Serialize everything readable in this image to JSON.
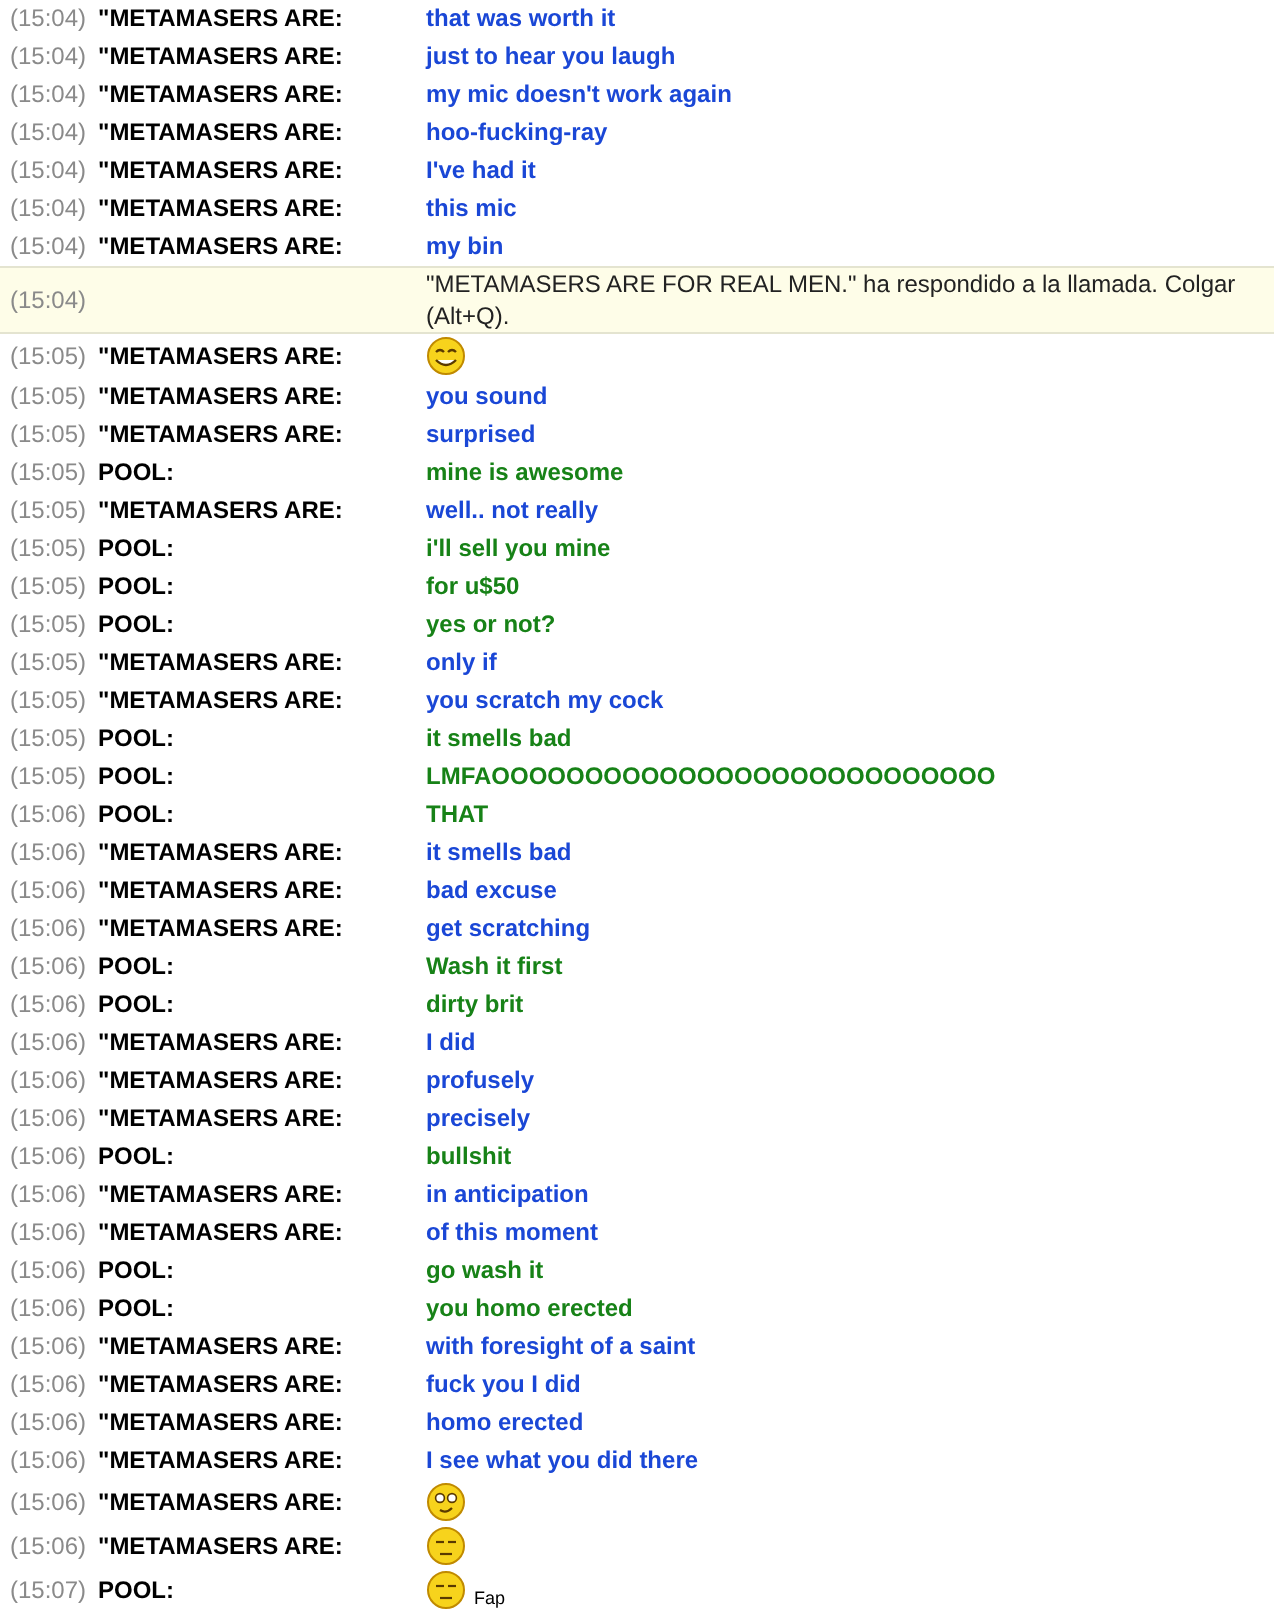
{
  "messages": [
    {
      "kind": "text",
      "time": "(15:04)",
      "sender": "\"METAMASERS ARE:",
      "text": "that was worth it",
      "color": "#1a47d6"
    },
    {
      "kind": "text",
      "time": "(15:04)",
      "sender": "\"METAMASERS ARE:",
      "text": "just to hear you laugh",
      "color": "#1a47d6"
    },
    {
      "kind": "text",
      "time": "(15:04)",
      "sender": "\"METAMASERS ARE:",
      "text": "my mic doesn't work again",
      "color": "#1a47d6"
    },
    {
      "kind": "text",
      "time": "(15:04)",
      "sender": "\"METAMASERS ARE:",
      "text": "hoo-fucking-ray",
      "color": "#1a47d6"
    },
    {
      "kind": "text",
      "time": "(15:04)",
      "sender": "\"METAMASERS ARE:",
      "text": "I've had it",
      "color": "#1a47d6"
    },
    {
      "kind": "text",
      "time": "(15:04)",
      "sender": "\"METAMASERS ARE:",
      "text": "this mic",
      "color": "#1a47d6"
    },
    {
      "kind": "text",
      "time": "(15:04)",
      "sender": "\"METAMASERS ARE:",
      "text": "my bin",
      "color": "#1a47d6"
    },
    {
      "kind": "notice",
      "time": "(15:04)",
      "text": "\"METAMASERS ARE FOR REAL MEN.\" ha respondido a la llamada. Colgar (Alt+Q)."
    },
    {
      "kind": "grin",
      "time": "(15:05)",
      "sender": "\"METAMASERS ARE:"
    },
    {
      "kind": "text",
      "time": "(15:05)",
      "sender": "\"METAMASERS ARE:",
      "text": "you sound",
      "color": "#1a47d6"
    },
    {
      "kind": "text",
      "time": "(15:05)",
      "sender": "\"METAMASERS ARE:",
      "text": "surprised",
      "color": "#1a47d6"
    },
    {
      "kind": "text",
      "time": "(15:05)",
      "sender": "POOL:",
      "text": "mine is awesome",
      "color": "#178217"
    },
    {
      "kind": "text",
      "time": "(15:05)",
      "sender": "\"METAMASERS ARE:",
      "text": "well.. not really",
      "color": "#1a47d6"
    },
    {
      "kind": "text",
      "time": "(15:05)",
      "sender": "POOL:",
      "text": "i'll sell you mine",
      "color": "#178217"
    },
    {
      "kind": "text",
      "time": "(15:05)",
      "sender": "POOL:",
      "text": "for u$50",
      "color": "#178217"
    },
    {
      "kind": "text",
      "time": "(15:05)",
      "sender": "POOL:",
      "text": "yes or not?",
      "color": "#178217"
    },
    {
      "kind": "text",
      "time": "(15:05)",
      "sender": "\"METAMASERS ARE:",
      "text": "only if",
      "color": "#1a47d6"
    },
    {
      "kind": "text",
      "time": "(15:05)",
      "sender": "\"METAMASERS ARE:",
      "text": "you scratch my cock",
      "color": "#1a47d6"
    },
    {
      "kind": "text",
      "time": "(15:05)",
      "sender": "POOL:",
      "text": "it smells bad",
      "color": "#178217"
    },
    {
      "kind": "text",
      "time": "(15:05)",
      "sender": "POOL:",
      "text": "LMFAOOOOOOOOOOOOOOOOOOOOOOOOOOO",
      "color": "#178217"
    },
    {
      "kind": "text",
      "time": "(15:06)",
      "sender": "POOL:",
      "text": "THAT",
      "color": "#178217"
    },
    {
      "kind": "text",
      "time": "(15:06)",
      "sender": "\"METAMASERS ARE:",
      "text": "it smells bad",
      "color": "#1a47d6"
    },
    {
      "kind": "text",
      "time": "(15:06)",
      "sender": "\"METAMASERS ARE:",
      "text": "bad excuse",
      "color": "#1a47d6"
    },
    {
      "kind": "text",
      "time": "(15:06)",
      "sender": "\"METAMASERS ARE:",
      "text": "get scratching",
      "color": "#1a47d6"
    },
    {
      "kind": "text",
      "time": "(15:06)",
      "sender": "POOL:",
      "text": "Wash it first",
      "color": "#178217"
    },
    {
      "kind": "text",
      "time": "(15:06)",
      "sender": "POOL:",
      "text": "dirty brit",
      "color": "#178217"
    },
    {
      "kind": "text",
      "time": "(15:06)",
      "sender": "\"METAMASERS ARE:",
      "text": "I did",
      "color": "#1a47d6"
    },
    {
      "kind": "text",
      "time": "(15:06)",
      "sender": "\"METAMASERS ARE:",
      "text": "profusely",
      "color": "#1a47d6"
    },
    {
      "kind": "text",
      "time": "(15:06)",
      "sender": "\"METAMASERS ARE:",
      "text": "precisely",
      "color": "#1a47d6"
    },
    {
      "kind": "text",
      "time": "(15:06)",
      "sender": "POOL:",
      "text": "bullshit",
      "color": "#178217"
    },
    {
      "kind": "text",
      "time": "(15:06)",
      "sender": "\"METAMASERS ARE:",
      "text": "in anticipation",
      "color": "#1a47d6"
    },
    {
      "kind": "text",
      "time": "(15:06)",
      "sender": "\"METAMASERS ARE:",
      "text": "of this moment",
      "color": "#1a47d6"
    },
    {
      "kind": "text",
      "time": "(15:06)",
      "sender": "POOL:",
      "text": "go wash it",
      "color": "#178217"
    },
    {
      "kind": "text",
      "time": "(15:06)",
      "sender": "POOL:",
      "text": "you homo erected",
      "color": "#178217"
    },
    {
      "kind": "text",
      "time": "(15:06)",
      "sender": "\"METAMASERS ARE:",
      "text": "with foresight of a saint",
      "color": "#1a47d6"
    },
    {
      "kind": "text",
      "time": "(15:06)",
      "sender": "\"METAMASERS ARE:",
      "text": "fuck you I did",
      "color": "#1a47d6"
    },
    {
      "kind": "text",
      "time": "(15:06)",
      "sender": "\"METAMASERS ARE:",
      "text": "homo erected",
      "color": "#1a47d6"
    },
    {
      "kind": "text",
      "time": "(15:06)",
      "sender": "\"METAMASERS ARE:",
      "text": "I see what you did there",
      "color": "#1a47d6"
    },
    {
      "kind": "wide",
      "time": "(15:06)",
      "sender": "\"METAMASERS ARE:"
    },
    {
      "kind": "flat",
      "time": "(15:06)",
      "sender": "\"METAMASERS ARE:"
    },
    {
      "kind": "flat",
      "time": "(15:07)",
      "sender": "POOL:",
      "text": "Fap"
    }
  ]
}
